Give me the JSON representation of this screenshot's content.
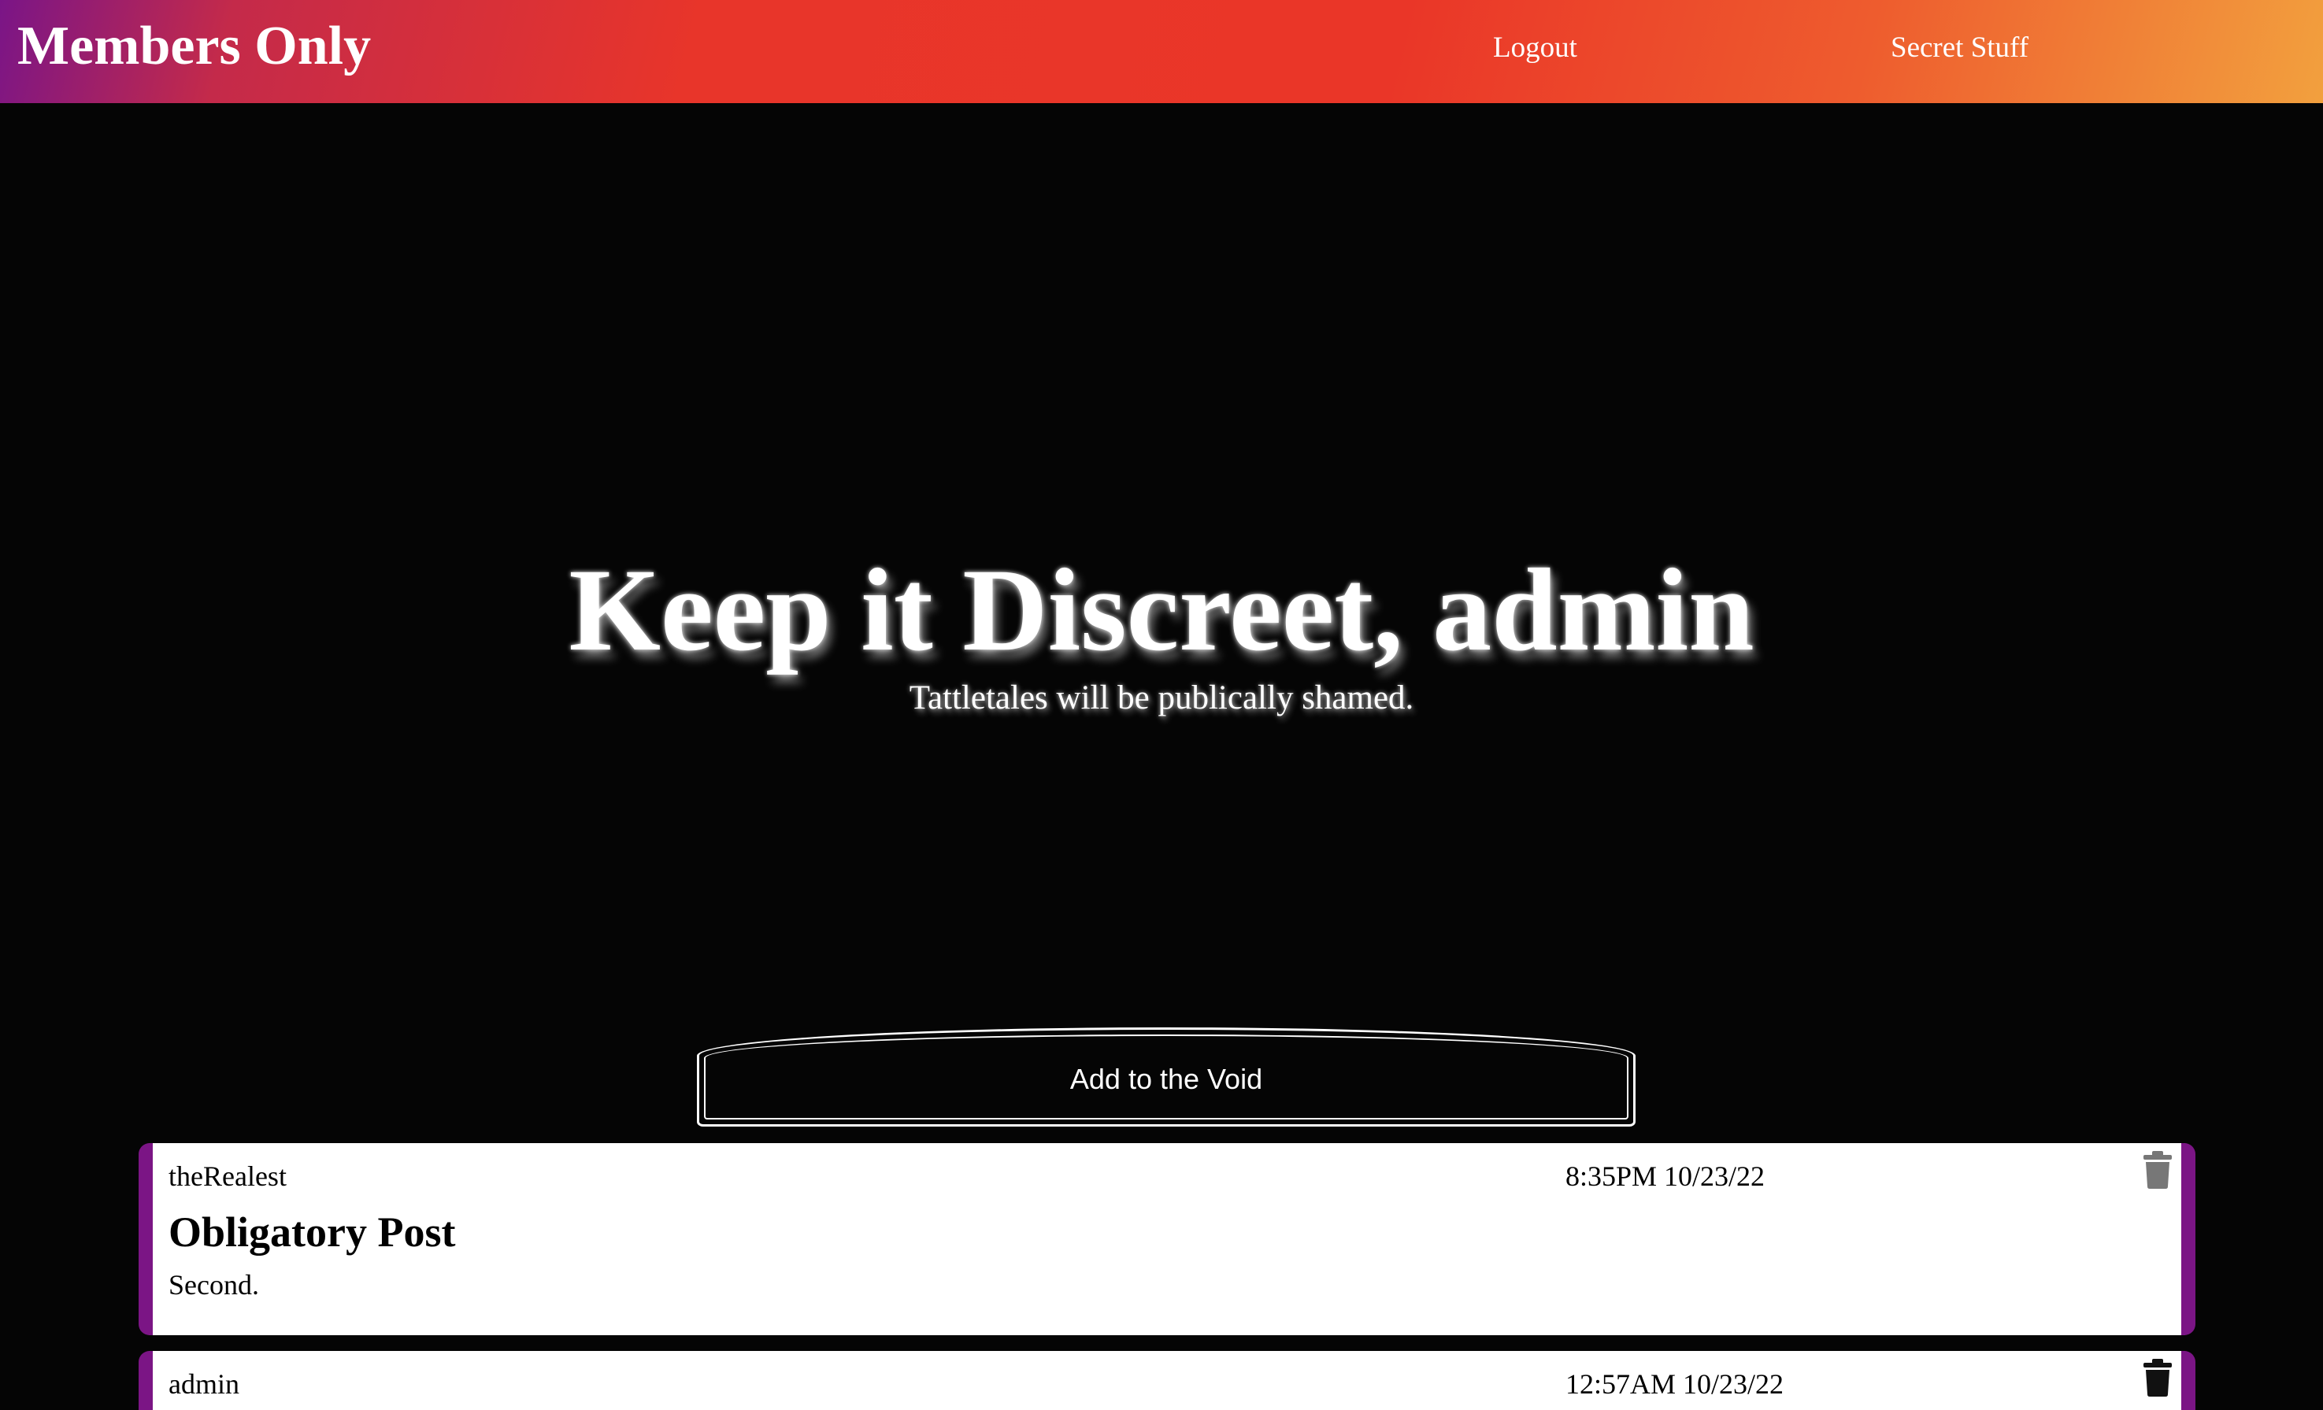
{
  "navbar": {
    "brand": "Members Only",
    "links": [
      {
        "label": "Logout"
      },
      {
        "label": "Secret Stuff"
      }
    ]
  },
  "hero": {
    "title": "Keep it Discreet, admin",
    "subtitle": "Tattletales will be publically shamed."
  },
  "compose": {
    "button_label": "Add to the Void"
  },
  "posts": [
    {
      "author": "theRealest",
      "timestamp": "8:35PM 10/23/22",
      "title": "Obligatory Post",
      "body": "Second.",
      "delete_icon": "trash-icon",
      "delete_color": "#777777"
    },
    {
      "author": "admin",
      "timestamp": "12:57AM 10/23/22",
      "delete_icon": "trash-icon",
      "delete_color": "#111111"
    }
  ],
  "colors": {
    "background": "#050505",
    "accent": "#7b1585",
    "header_gradient": [
      "#7a1587",
      "#e8352a",
      "#f2a03e"
    ]
  }
}
